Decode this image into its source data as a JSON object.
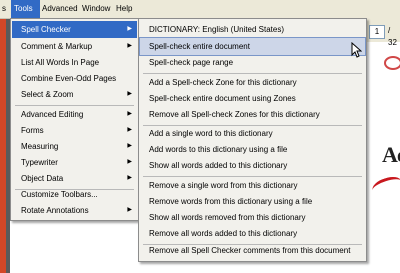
{
  "menubar": {
    "items": [
      {
        "label": "s"
      },
      {
        "label": "Tools"
      },
      {
        "label": "Advanced"
      },
      {
        "label": "Window"
      },
      {
        "label": "Help"
      }
    ]
  },
  "toolbar": {
    "page_current": "1",
    "page_total": "/ 32"
  },
  "document": {
    "text": "Ad"
  },
  "tools_menu": {
    "items": [
      {
        "label": "Spell Checker",
        "mnemonic_hint": "",
        "submenu": true
      },
      {
        "label": "Comment & Markup",
        "submenu": true
      },
      {
        "label": "List All Words In Page",
        "submenu": false
      },
      {
        "label": "Combine Even-Odd Pages",
        "submenu": false
      },
      {
        "label": "Select & Zoom",
        "submenu": true
      },
      {
        "label": "Advanced Editing",
        "submenu": true
      },
      {
        "label": "Forms",
        "submenu": true
      },
      {
        "label": "Measuring",
        "submenu": true
      },
      {
        "label": "Typewriter",
        "submenu": true
      },
      {
        "label": "Object Data",
        "submenu": true
      },
      {
        "label": "Customize Toolbars...",
        "submenu": false
      },
      {
        "label": "Rotate Annotations",
        "submenu": true
      }
    ]
  },
  "spell_menu": {
    "items": [
      {
        "label": "DICTIONARY: English (United States)"
      },
      {
        "label": "Spell-check entire document"
      },
      {
        "label": "Spell-check page range"
      },
      {
        "label": "Add a Spell-check Zone for this dictionary"
      },
      {
        "label": "Spell-check entire document using Zones"
      },
      {
        "label": "Remove all Spell-check Zones for this dictionary"
      },
      {
        "label": "Add a single word to this dictionary"
      },
      {
        "label": "Add words to this dictionary using a file"
      },
      {
        "label": "Show all words added to this dictionary"
      },
      {
        "label": "Remove a single word from this dictionary"
      },
      {
        "label": "Remove words from this dictionary using a file"
      },
      {
        "label": "Show all words removed from this dictionary"
      },
      {
        "label": "Remove all words added to this dictionary"
      },
      {
        "label": "Remove all Spell Checker comments from this document"
      }
    ]
  },
  "colors": {
    "highlight": "#316ac5",
    "hover": "#cdd6e8",
    "menu_bg": "#f2f1ec"
  }
}
